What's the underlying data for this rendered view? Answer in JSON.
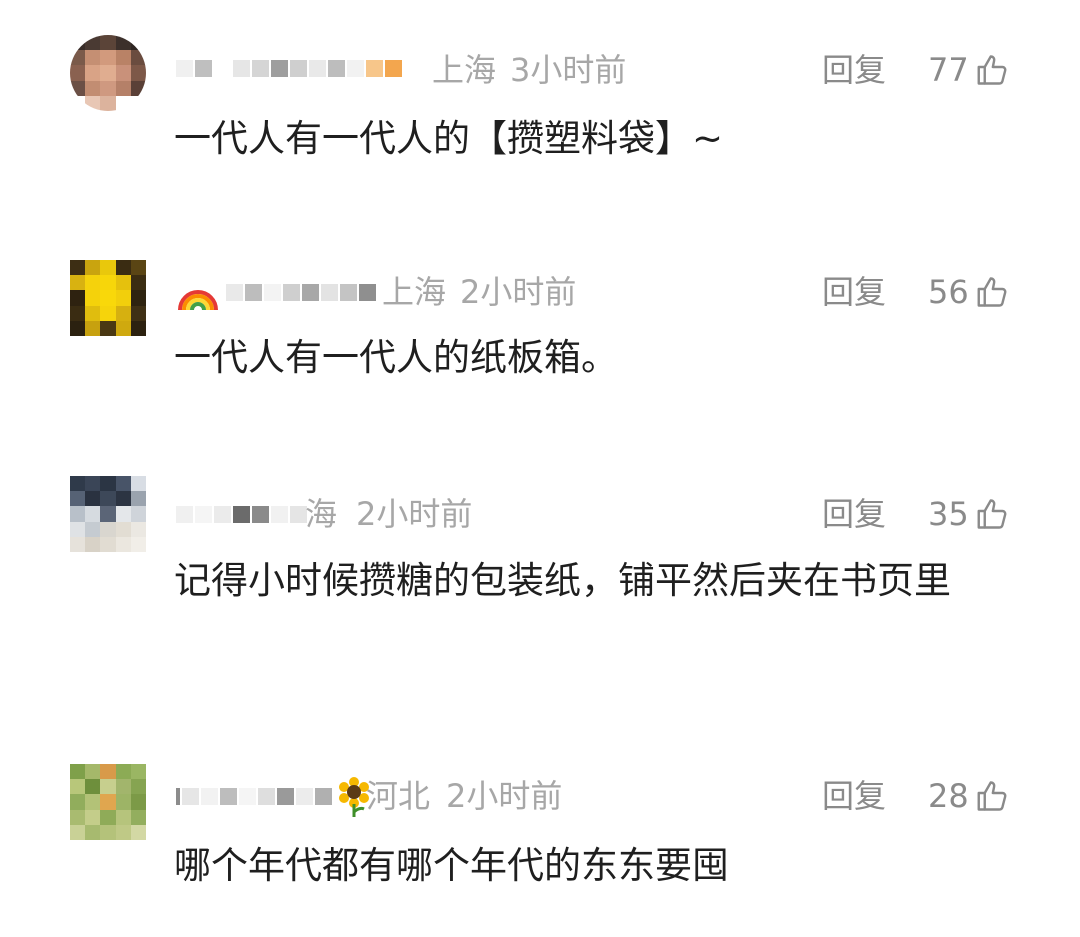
{
  "comments": [
    {
      "location": "上海",
      "time": "3小时前",
      "reply_label": "回复",
      "likes": "77",
      "text": "一代人有一代人的【攒塑料袋】~"
    },
    {
      "location": "上海",
      "time": "2小时前",
      "reply_label": "回复",
      "likes": "56",
      "text": "一代人有一代人的纸板箱。"
    },
    {
      "location": "海",
      "time": "2小时前",
      "reply_label": "回复",
      "likes": "35",
      "text": "记得小时候攒糖的包装纸，铺平然后夹在书页里"
    },
    {
      "location": "河北",
      "time": "2小时前",
      "reply_label": "回复",
      "likes": "28",
      "text": "哪个年代都有哪个年代的东东要囤"
    }
  ],
  "icons": {
    "like": "thumbs-up-icon",
    "sunflower": "sunflower-emoji",
    "rainbow": "rainbow-emoji"
  }
}
